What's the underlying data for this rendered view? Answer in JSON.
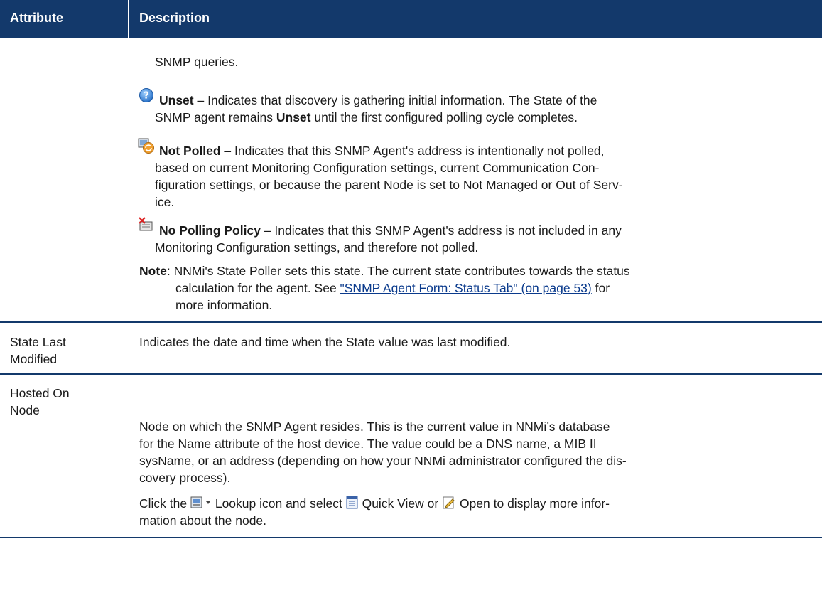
{
  "header": {
    "col1": "Attribute",
    "col2": "Description"
  },
  "state_cont": {
    "line1": "SNMP queries."
  },
  "unset": {
    "name": "Unset",
    "l1": " – Indicates that discovery is gathering initial information. The State of the",
    "l2a": "SNMP agent remains ",
    "l2b": "Unset",
    "l2c": " until the first configured polling cycle completes."
  },
  "not_polled": {
    "name": "Not Polled",
    "l1": " – Indicates that this SNMP Agent's address is intentionally not polled,",
    "l2": "based on current Monitoring Configuration settings, current Communication Con-",
    "l3": "figuration settings, or because the parent Node is set to Not Managed or Out of Serv-",
    "l4": "ice."
  },
  "no_policy": {
    "name": "No Polling Policy",
    "l1": " – Indicates that this SNMP Agent's address is not included in any",
    "l2": "Monitoring Configuration settings, and therefore not polled."
  },
  "note": {
    "label": "Note",
    "l1": ": NNMi's State Poller sets this state. The current state contributes towards the status",
    "l2": "calculation for the agent. See ",
    "link": "\"SNMP Agent Form: Status Tab\" (on page 53)",
    "l2b": " for",
    "l3": "more information."
  },
  "row_state_last": {
    "attr1": "State Last",
    "attr2": "Modified",
    "desc": "Indicates the date and time when the State value was last modified."
  },
  "row_hosted": {
    "attr1": "Hosted On",
    "attr2": "Node",
    "d1": "Node on which the SNMP Agent resides. This is the current value in NNMi’s database",
    "d2": "for the Name attribute of the host device. The value could be a DNS name, a MIB II",
    "d3": "sysName, or an address (depending on how your NNMi administrator configured the dis-",
    "d4": "covery process).",
    "c1a": "Click the ",
    "c1b": " Lookup icon and select ",
    "c1c": " Quick View or ",
    "c1d": " Open to display more infor-",
    "c2": "mation about the node."
  },
  "icons": [
    "unset-status-icon",
    "not-polled-icon",
    "no-polling-policy-icon",
    "lookup-icon",
    "quick-view-icon",
    "open-icon"
  ],
  "colors": {
    "header_bg": "#13396b",
    "link": "#0a3a8c"
  }
}
